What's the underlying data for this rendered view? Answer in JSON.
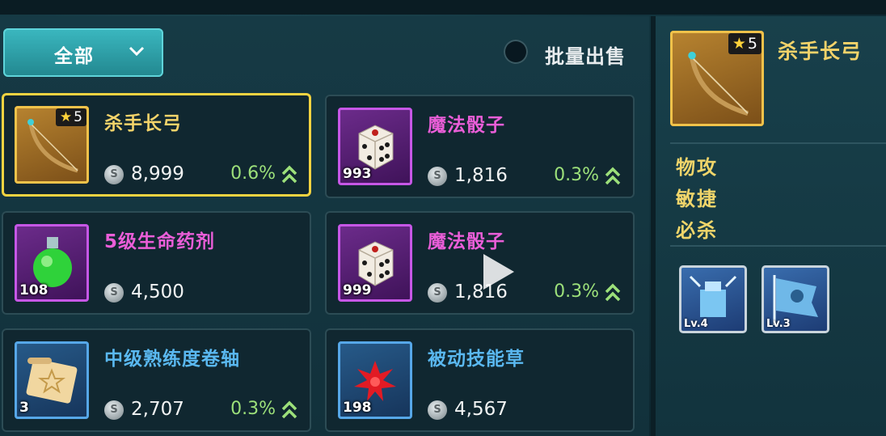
{
  "filter": {
    "label": "全部"
  },
  "batch_sell": {
    "label": "批量出售"
  },
  "items": [
    {
      "name": "杀手长弓",
      "stars": "5",
      "price": "8,999",
      "pct": "0.6%",
      "rarity": "gold",
      "icon": "longbow-icon"
    },
    {
      "name": "魔法骰子",
      "count": "993",
      "price": "1,816",
      "pct": "0.3%",
      "rarity": "purple",
      "icon": "dice-icon"
    },
    {
      "name": "5级生命药剂",
      "count": "108",
      "price": "4,500",
      "rarity": "purple",
      "icon": "potion-icon"
    },
    {
      "name": "魔法骰子",
      "count": "999",
      "price": "1,816",
      "pct": "0.3%",
      "rarity": "purple",
      "icon": "dice-icon"
    },
    {
      "name": "中级熟练度卷轴",
      "count": "3",
      "price": "2,707",
      "pct": "0.3%",
      "rarity": "blue",
      "icon": "scroll-icon"
    },
    {
      "name": "被动技能草",
      "count": "198",
      "price": "4,567",
      "rarity": "blue",
      "icon": "red-herb-icon"
    }
  ],
  "detail": {
    "name": "杀手长弓",
    "stars": "5",
    "stats": [
      "物攻",
      "敏捷",
      "必杀"
    ],
    "skills": [
      {
        "level": "Lv.4",
        "icon": "frost-tower-skill-icon"
      },
      {
        "level": "Lv.3",
        "icon": "ice-banner-skill-icon"
      }
    ]
  },
  "colors": {
    "gold": "#f0c24a",
    "purple": "#c657e6",
    "blue": "#56a7e8",
    "up_arrow": "#9ce07a",
    "selected_border": "#f2d341"
  }
}
